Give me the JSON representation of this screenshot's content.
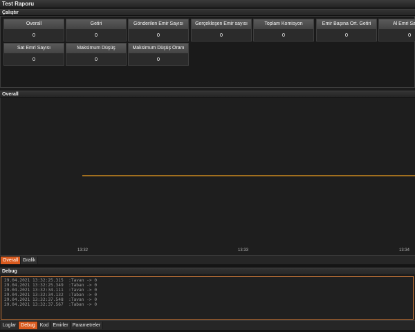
{
  "window": {
    "title": "Test Raporu"
  },
  "sections": {
    "run": "Çalıştır",
    "chart": "Overall",
    "debug": "Debug"
  },
  "metrics": [
    {
      "label": "Overall",
      "value": "0"
    },
    {
      "label": "Getiri",
      "value": "0"
    },
    {
      "label": "Gönderilen Emir Sayısı",
      "value": "0"
    },
    {
      "label": "Gerçekleşen Emir sayısı",
      "value": "0"
    },
    {
      "label": "Toplam Komisyon",
      "value": "0"
    },
    {
      "label": "Emir Başına Ort. Getiri",
      "value": "0"
    },
    {
      "label": "Al Emri Sa",
      "value": "0"
    },
    {
      "label": "Sat Emri Sayısı",
      "value": "0"
    },
    {
      "label": "Maksimum Düşüş",
      "value": "0"
    },
    {
      "label": "Maksimum Düşüş Oranı",
      "value": "0"
    }
  ],
  "chart": {
    "x_ticks": [
      "13:32",
      "13:33",
      "13:34"
    ],
    "line_color": "#f0a020"
  },
  "chart_tabs": [
    {
      "label": "Overall",
      "active": true
    },
    {
      "label": "Grafik",
      "active": false
    }
  ],
  "debug_lines": [
    "29.04.2021 13:32:25.315  :Tavan -> 0",
    "29.04.2021 13:32:25.349  :Taban -> 0",
    "29.04.2021 13:32:34.111  :Tavan -> 0",
    "29.04.2021 13:32:34.132  :Taban -> 0",
    "29.04.2021 13:32:37.548  :Tavan -> 0",
    "29.04.2021 13:32:37.567  :Taban -> 0"
  ],
  "bottom_tabs": [
    {
      "label": "Loglar",
      "active": false
    },
    {
      "label": "Debug",
      "active": true
    },
    {
      "label": "Kod",
      "active": false
    },
    {
      "label": "Emirler",
      "active": false
    },
    {
      "label": "Parametreler",
      "active": false
    }
  ]
}
